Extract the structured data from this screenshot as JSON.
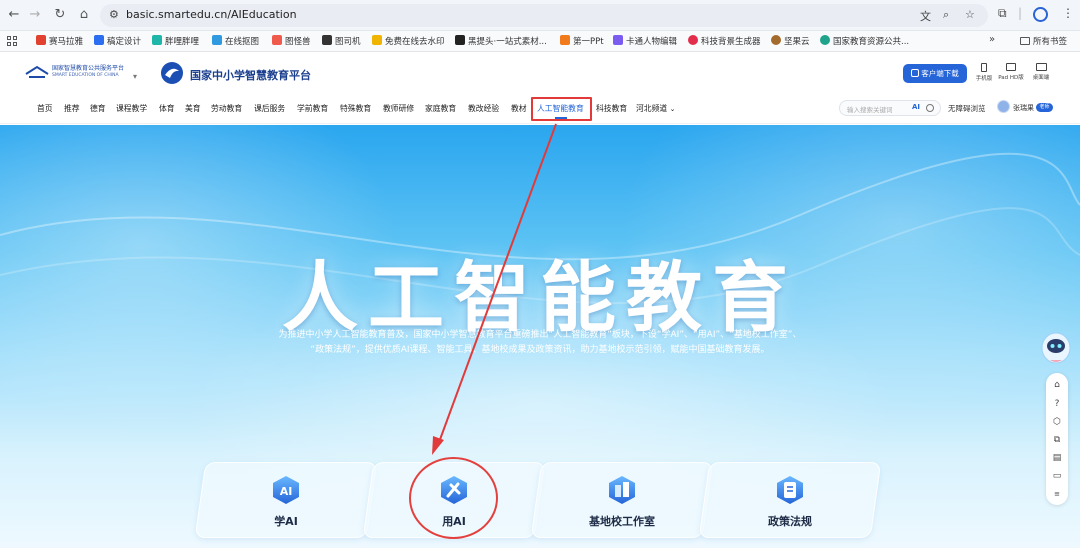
{
  "browser": {
    "url": "basic.smartedu.cn/AIEducation",
    "bookmarks": [
      {
        "label": "赛马拉雅",
        "color": "#e2412f"
      },
      {
        "label": "稿定设计",
        "color": "#2b6ef0"
      },
      {
        "label": "胖哩胖哩",
        "color": "#1fb5a8"
      },
      {
        "label": "在线抠图",
        "color": "#2f9ae0"
      },
      {
        "label": "图怪兽",
        "color": "#f05a4c"
      },
      {
        "label": "图司机",
        "color": "#333333"
      },
      {
        "label": "免费在线去水印",
        "color": "#f0b400"
      },
      {
        "label": "黑提头·一站式素材...",
        "color": "#222222"
      },
      {
        "label": "第一PPt",
        "color": "#f07a1c"
      },
      {
        "label": "卡通人物编辑",
        "color": "#7a5cf0"
      },
      {
        "label": "科技背景生成器",
        "color": "#e22d4b"
      },
      {
        "label": "坚果云",
        "color": "#a36b2c"
      },
      {
        "label": "国家教育资源公共...",
        "color": "#1fa38a"
      }
    ],
    "all_bookmarks": "所有书签"
  },
  "site": {
    "logo_platform_cn": "国家智慧教育公共服务平台",
    "logo_platform_en": "SMART EDUCATION OF CHINA",
    "logo_title": "国家中小学智慧教育平台",
    "download_btn": "客户端下载",
    "devices": [
      "手机版",
      "Pad HD版",
      "桌面端"
    ],
    "nav": [
      "首页",
      "推荐",
      "德育",
      "课程教学",
      "体育",
      "美育",
      "劳动教育",
      "课后服务",
      "学前教育",
      "特殊教育",
      "教师研修",
      "家庭教育",
      "教改经验",
      "教材",
      "人工智能教育",
      "科技教育",
      "河北频道"
    ],
    "active_nav": "人工智能教育",
    "search_placeholder": "输入搜索关键词",
    "search_ai": "AI",
    "accessibility": "无障碍浏览",
    "user_name": "张瑞果",
    "user_badge": "老师"
  },
  "hero": {
    "title": "人工智能教育",
    "desc_line1": "为推进中小学人工智能教育普及，国家中小学智慧教育平台重磅推出“人工智能教育”板块，下设“学AI”、“用AI”、“基地校工作室”、",
    "desc_line2": "“政策法规”，提供优质AI课程、智能工具、基地校成果及政策资讯，助力基地校示范引领，赋能中国基础教育发展。",
    "cards": [
      {
        "label": "学AI",
        "icon": "ai-badge-icon"
      },
      {
        "label": "用AI",
        "icon": "tools-icon"
      },
      {
        "label": "基地校工作室",
        "icon": "school-building-icon"
      },
      {
        "label": "政策法规",
        "icon": "policy-document-icon"
      }
    ]
  },
  "colors": {
    "accent": "#2565d8",
    "annotation": "#e23a3a"
  }
}
